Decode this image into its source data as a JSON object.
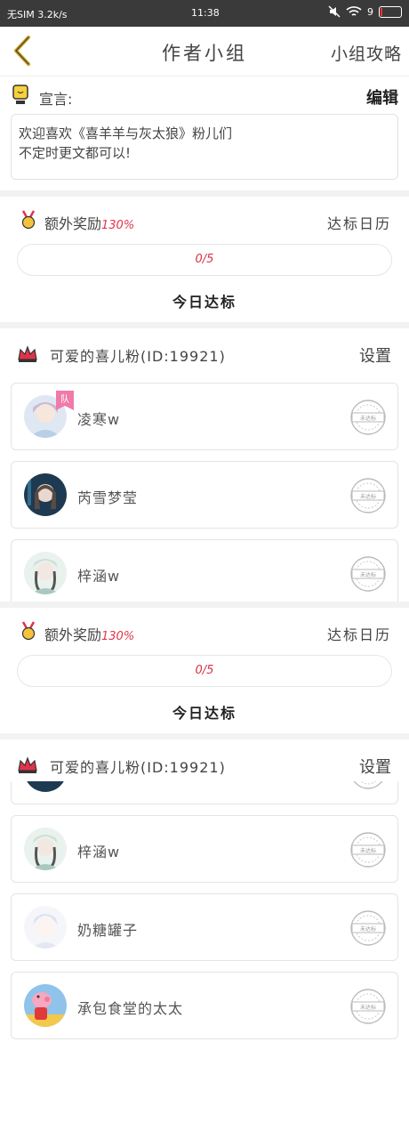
{
  "status_bar": {
    "left": "无SIM 3.2k/s",
    "time": "11:38",
    "battery": "9"
  },
  "nav": {
    "title": "作者小组",
    "right_link": "小组攻略"
  },
  "declaration": {
    "label": "宣言:",
    "edit": "编辑",
    "line1": "欢迎喜欢《喜羊羊与灰太狼》粉儿们",
    "line2": "不定时更文都可以!"
  },
  "reward": {
    "label": "额外奖励",
    "percent": "130%",
    "calendar": "达标日历",
    "progress": "0/5",
    "progress_value": 0,
    "progress_total": 5,
    "today": "今日达标"
  },
  "group": {
    "name": "可爱的喜儿粉(ID:19921)",
    "settings": "设置"
  },
  "members_top": [
    {
      "name": "凌寒w",
      "badge": "队",
      "status": "未达标"
    },
    {
      "name": "芮雪梦莹",
      "status": "未达标"
    },
    {
      "name": "梓涵w",
      "status": "未达标"
    }
  ],
  "members_bottom": [
    {
      "name": "梓涵w",
      "status": "未达标"
    },
    {
      "name": "奶糖罐子",
      "status": "未达标"
    },
    {
      "name": "承包食堂的太太",
      "status": "未达标"
    }
  ],
  "colors": {
    "accent_red": "#e0334a",
    "back_arrow": "#c9a227",
    "badge_pink": "#f07aa8"
  }
}
